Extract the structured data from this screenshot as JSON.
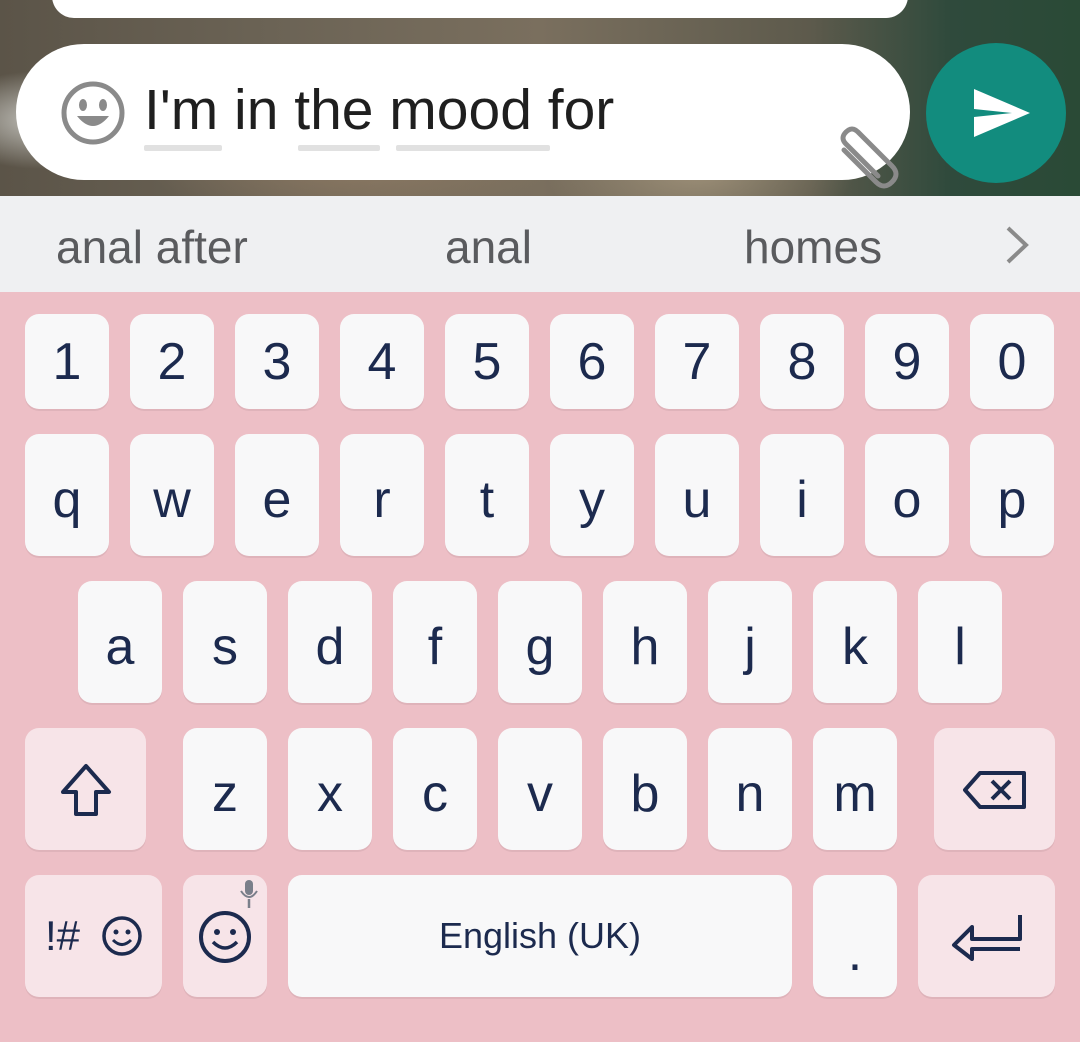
{
  "composer": {
    "message_text": "I'm in the mood for"
  },
  "suggestions": [
    "anal after",
    "anal",
    "homes"
  ],
  "keyboard": {
    "row_numbers": [
      "1",
      "2",
      "3",
      "4",
      "5",
      "6",
      "7",
      "8",
      "9",
      "0"
    ],
    "row_1": [
      "q",
      "w",
      "e",
      "r",
      "t",
      "y",
      "u",
      "i",
      "o",
      "p"
    ],
    "row_2": [
      "a",
      "s",
      "d",
      "f",
      "g",
      "h",
      "j",
      "k",
      "l"
    ],
    "row_3": [
      "z",
      "x",
      "c",
      "v",
      "b",
      "n",
      "m"
    ],
    "symbols_label": "!#",
    "space_label": "English (UK)",
    "period_label": "."
  },
  "colors": {
    "keyboard_bg": "#edbfc6",
    "key_bg": "#f8f8f9",
    "func_key_bg": "#f7e4e8",
    "key_text": "#1c2a4e",
    "send_button": "#128c7e",
    "suggestion_bar": "#eff0f2"
  },
  "icons": [
    "emoji-icon",
    "attach-icon",
    "send-icon",
    "chevron-right-icon",
    "shift-icon",
    "backspace-icon",
    "emoji-keyboard-icon",
    "mic-icon",
    "enter-icon"
  ]
}
